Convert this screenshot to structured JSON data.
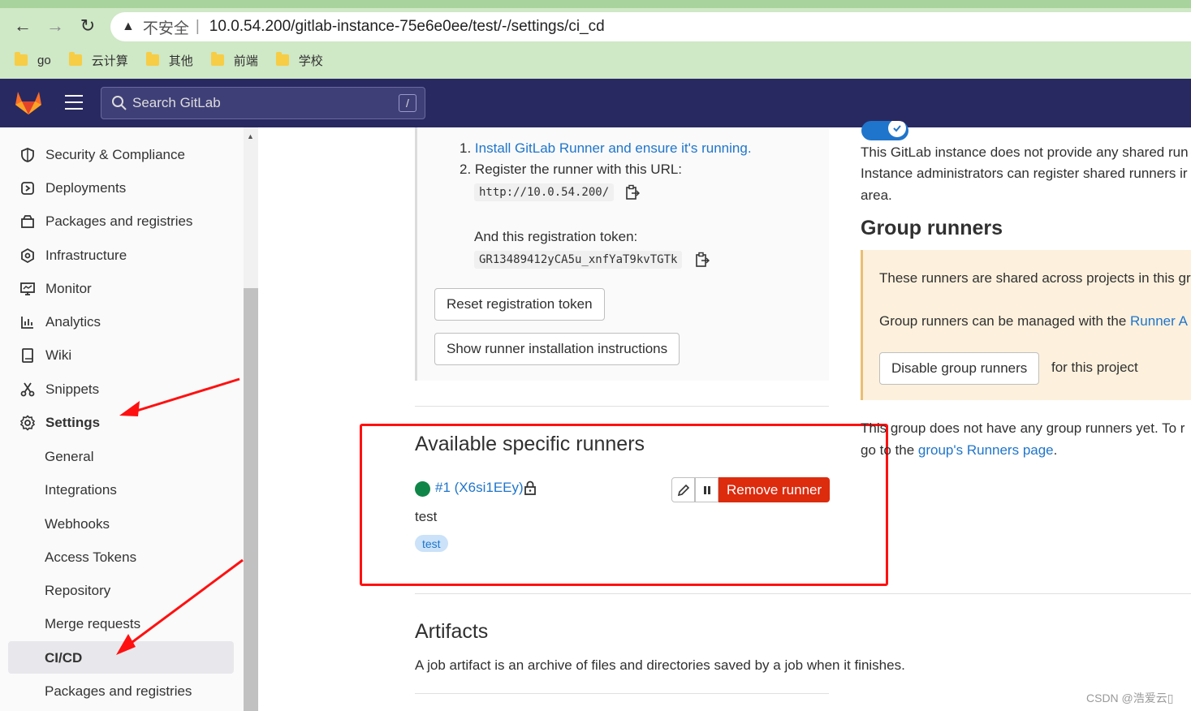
{
  "browser": {
    "address": {
      "warning_label": "不安全",
      "separator": "|",
      "url": "10.0.54.200/gitlab-instance-75e6e0ee/test/-/settings/ci_cd"
    },
    "bookmarks": [
      "go",
      "云计算",
      "其他",
      "前端",
      "学校"
    ]
  },
  "header": {
    "search_placeholder": "Search GitLab",
    "search_shortcut": "/"
  },
  "sidebar": {
    "items": [
      {
        "label": "Security & Compliance",
        "icon": "shield-icon"
      },
      {
        "label": "Deployments",
        "icon": "deployments-icon"
      },
      {
        "label": "Packages and registries",
        "icon": "package-icon"
      },
      {
        "label": "Infrastructure",
        "icon": "cloud-gear-icon"
      },
      {
        "label": "Monitor",
        "icon": "monitor-icon"
      },
      {
        "label": "Analytics",
        "icon": "analytics-icon"
      },
      {
        "label": "Wiki",
        "icon": "book-icon"
      },
      {
        "label": "Snippets",
        "icon": "scissors-icon"
      },
      {
        "label": "Settings",
        "icon": "settings-icon"
      }
    ],
    "settings_sub": [
      "General",
      "Integrations",
      "Webhooks",
      "Access Tokens",
      "Repository",
      "Merge requests",
      "CI/CD",
      "Packages and registries"
    ],
    "active": "CI/CD"
  },
  "specific_runners_setup": {
    "step1_num": "1.",
    "step1_link": "Install GitLab Runner and ensure it's running.",
    "step2_num": "2.",
    "step2_text": "Register the runner with this URL:",
    "url_code": "http://10.0.54.200/",
    "token_label": "And this registration token:",
    "token_code": "GR13489412yCA5u_xnfYaT9kvTGTk",
    "reset_button": "Reset registration token",
    "show_instructions_button": "Show runner installation instructions"
  },
  "available_runners": {
    "title": "Available specific runners",
    "runner_link": "#1 (X6si1EEy)",
    "runner_description": "test",
    "tag": "test",
    "remove_button": "Remove runner"
  },
  "shared_runners": {
    "line1": "This GitLab instance does not provide any shared run",
    "line2": "Instance administrators can register shared runners ir",
    "line3": "area."
  },
  "group_runners": {
    "title": "Group runners",
    "alert_line1": "These runners are shared across projects in this gr",
    "alert_line2_text": "Group runners can be managed with the ",
    "alert_line2_link": "Runner A",
    "disable_button": "Disable group runners",
    "disable_suffix": "for this project",
    "none_line1": "This group does not have any group runners yet. To r",
    "none_line2_prefix": "go to the ",
    "none_line2_link": "group's Runners page",
    "none_line2_suffix": "."
  },
  "artifacts": {
    "title": "Artifacts",
    "description": "A job artifact is an archive of files and directories saved by a job when it finishes."
  },
  "watermark": "CSDN @浩爱云▯"
}
